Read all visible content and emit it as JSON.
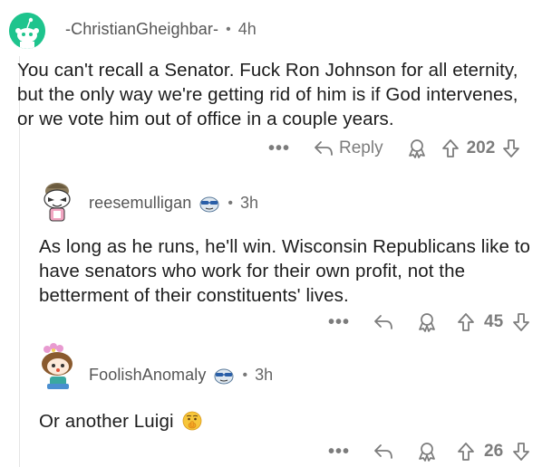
{
  "comments": [
    {
      "username": "-ChristianGheighbar-",
      "separator": "•",
      "time": "4h",
      "text": "You can't recall a Senator. Fuck Ron Johnson for all eternity, but the only way we're getting rid of him is if God intervenes, or we vote him out of office in a couple years.",
      "actions": {
        "more": "•••",
        "reply_label": "Reply",
        "votes": "202"
      },
      "avatar_icon": "reddit-snoo-avatar-icon",
      "avatar_color": "#1ec48d"
    },
    {
      "username": "reesemulligan",
      "separator": "•",
      "time": "3h",
      "text": "As long as he runs, he'll win. Wisconsin Republicans like to have senators who work for their own profit, not the betterment of their constituents' lives.",
      "actions": {
        "more": "•••",
        "votes": "45"
      },
      "avatar_icon": "custom-snoo-avatar-icon",
      "flair_icon": "sunglasses-face-flair-icon"
    },
    {
      "username": "FoolishAnomaly",
      "separator": "•",
      "time": "3h",
      "text": "Or another Luigi",
      "emoji": "shushing-face-emoji-icon",
      "actions": {
        "more": "•••",
        "votes": "26"
      },
      "avatar_icon": "custom-snoo-avatar-icon",
      "flair_icon": "sunglasses-face-flair-icon"
    }
  ],
  "colors": {
    "text": "#1c1c1c",
    "meta": "#7c7c7c",
    "thread_line": "#e5e5e5"
  }
}
